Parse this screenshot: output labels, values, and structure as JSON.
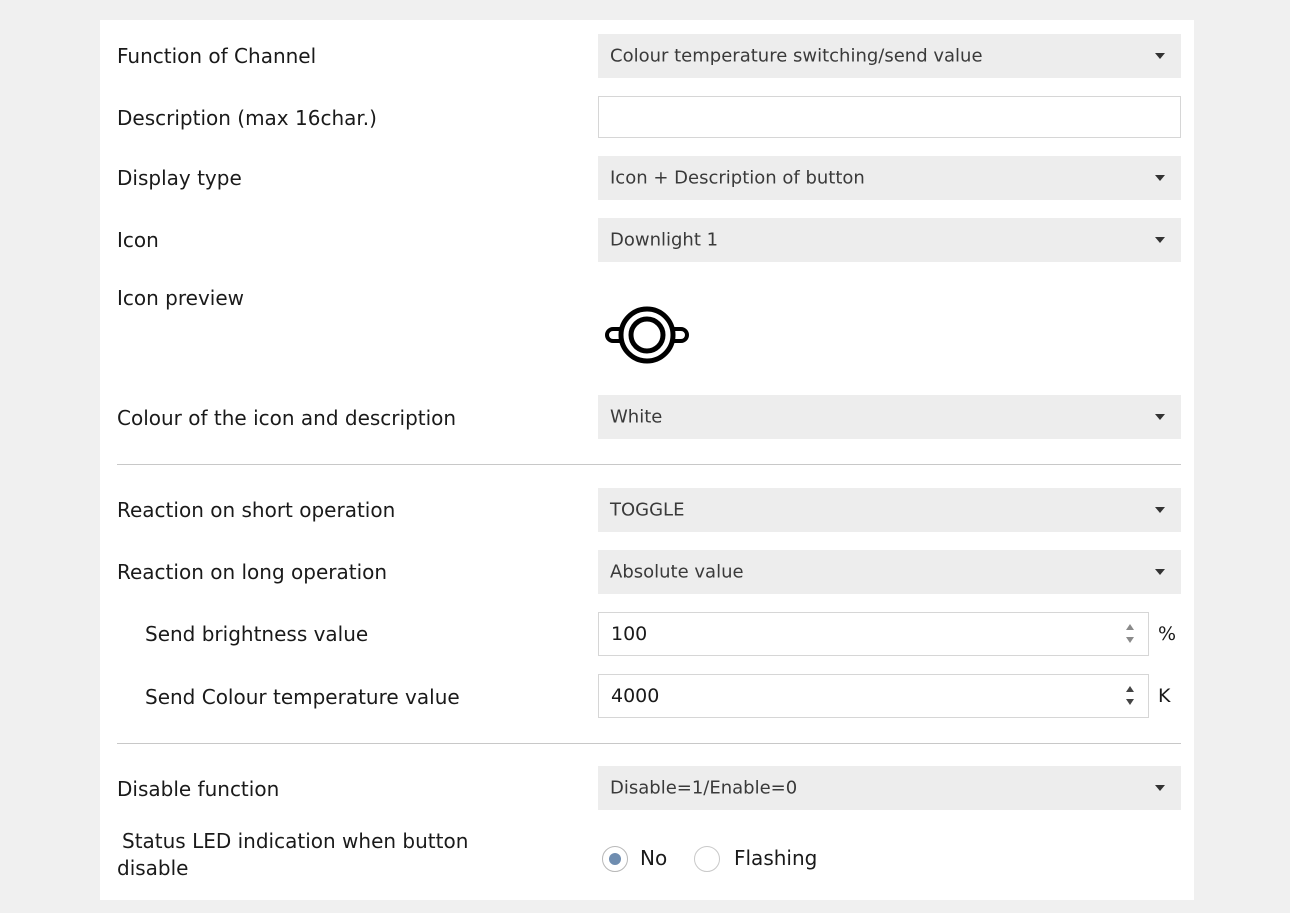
{
  "rows": {
    "function": {
      "label": "Function of Channel",
      "value": "Colour temperature switching/send value"
    },
    "description": {
      "label": "Description (max 16char.)",
      "value": ""
    },
    "display_type": {
      "label": "Display type",
      "value": "Icon + Description of button"
    },
    "icon": {
      "label": "Icon",
      "value": "Downlight 1"
    },
    "icon_preview": {
      "label": "Icon preview",
      "icon": "downlight-icon"
    },
    "colour": {
      "label": "Colour of the icon and description",
      "value": "White"
    },
    "short_op": {
      "label": "Reaction on short operation",
      "value": "TOGGLE"
    },
    "long_op": {
      "label": "Reaction on long operation",
      "value": "Absolute value"
    },
    "brightness": {
      "label": "Send brightness value",
      "value": "100",
      "unit": "%"
    },
    "colour_temp": {
      "label": "Send Colour temperature value",
      "value": "4000",
      "unit": "K"
    },
    "disable": {
      "label": "Disable function",
      "value": "Disable=1/Enable=0"
    },
    "status_led": {
      "label_line1": "Status LED indication when button",
      "label_line2": "disable",
      "options": [
        {
          "label": "No",
          "checked": true
        },
        {
          "label": "Flashing",
          "checked": false
        }
      ]
    }
  },
  "colors": {
    "radio_selected": "#6f8db0",
    "dropdown_bg": "#ededed"
  }
}
